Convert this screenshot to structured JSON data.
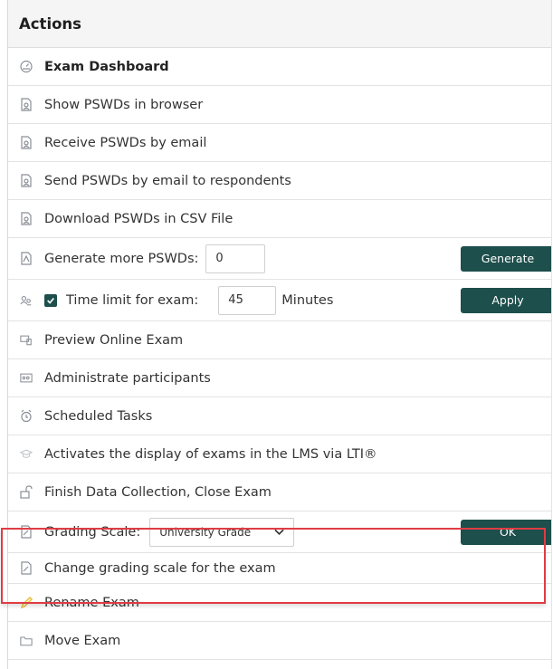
{
  "header": {
    "title": "Actions"
  },
  "rows": {
    "dashboard": {
      "label": "Exam Dashboard",
      "icon": "dashboard-icon"
    },
    "show_pswds": {
      "label": "Show PSWDs in browser",
      "icon": "document-user-icon"
    },
    "receive_pswds": {
      "label": "Receive PSWDs by email",
      "icon": "document-user-icon"
    },
    "send_pswds": {
      "label": "Send PSWDs by email to respondents",
      "icon": "document-user-icon"
    },
    "download_pswds": {
      "label": "Download PSWDs in CSV File",
      "icon": "document-user-icon"
    },
    "generate": {
      "label": "Generate more PSWDs:",
      "value": "0",
      "button": "Generate",
      "icon": "pdf-document-icon"
    },
    "time_limit": {
      "label": "Time limit for exam:",
      "value": "45",
      "unit": "Minutes",
      "button": "Apply",
      "checked": true,
      "icon": "users-icon"
    },
    "preview": {
      "label": "Preview Online Exam",
      "icon": "preview-icon"
    },
    "administrate": {
      "label": "Administrate participants",
      "icon": "participants-icon"
    },
    "scheduled": {
      "label": "Scheduled Tasks",
      "icon": "alarm-clock-icon"
    },
    "lti": {
      "label": "Activates the display of exams in the LMS via LTI®",
      "icon": "graduation-cap-icon"
    },
    "finish": {
      "label": "Finish Data Collection, Close Exam",
      "icon": "unlock-icon"
    },
    "grading_scale": {
      "label": "Grading Scale:",
      "selected": "University Grade",
      "button": "OK",
      "icon": "scale-document-icon"
    },
    "change_scale": {
      "label": "Change grading scale for the exam",
      "icon": "scale-document-icon"
    },
    "rename": {
      "label": "Rename Exam",
      "icon": "pencil-icon"
    },
    "move": {
      "label": "Move Exam",
      "icon": "folder-icon"
    }
  },
  "colors": {
    "button_bg": "#1d4f4c",
    "highlight_border": "#e03c45",
    "icon_gray": "#8a8f96",
    "pencil_yellow": "#e8c34a"
  }
}
